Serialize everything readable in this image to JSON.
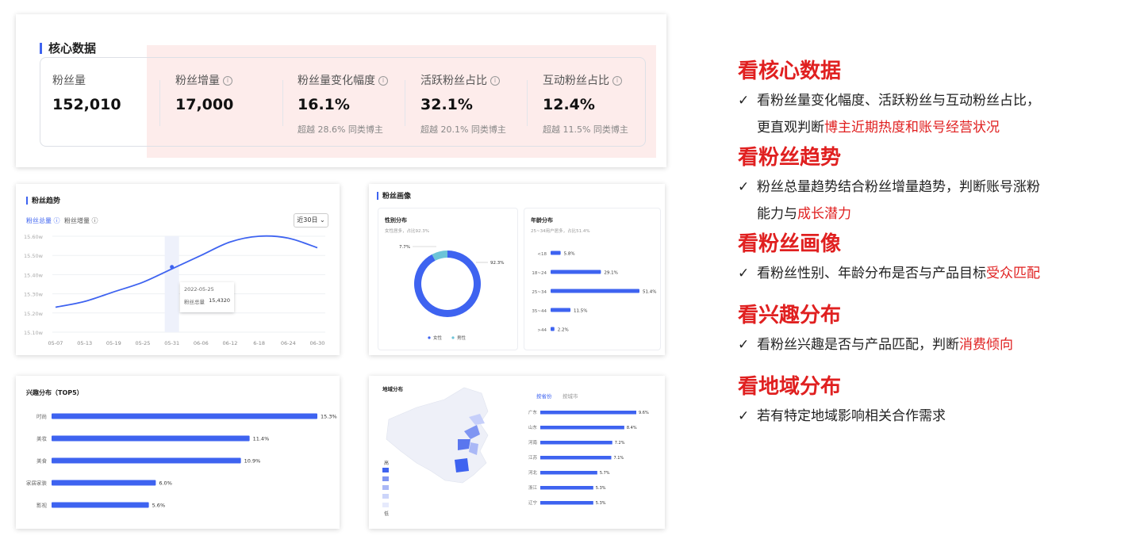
{
  "core": {
    "title": "核心数据",
    "metrics": [
      {
        "label": "粉丝量",
        "value": "152,010",
        "sub": "",
        "info": false
      },
      {
        "label": "粉丝增量",
        "value": "17,000",
        "sub": "",
        "info": true
      },
      {
        "label": "粉丝量变化幅度",
        "value": "16.1%",
        "sub": "超越 28.6% 同类博主",
        "info": true
      },
      {
        "label": "活跃粉丝占比",
        "value": "32.1%",
        "sub": "超越 20.1% 同类博主",
        "info": true
      },
      {
        "label": "互动粉丝占比",
        "value": "12.4%",
        "sub": "超越 11.5% 同类博主",
        "info": true
      }
    ],
    "info_icon": "ⓘ"
  },
  "trend": {
    "title": "粉丝趋势",
    "tab_total": "粉丝总量 ⓘ",
    "tab_increase": "粉丝增量 ⓘ",
    "range_select": "近30日 ⌄",
    "y_ticks": [
      "15.60w",
      "15.50w",
      "15.40w",
      "15.30w",
      "15.20w",
      "15.10w"
    ],
    "x_ticks": [
      "05-07",
      "05-13",
      "05-19",
      "05-25",
      "05-31",
      "06-06",
      "06-12",
      "6-18",
      "06-24",
      "06-30"
    ],
    "tooltip_date": "2022-05-25",
    "tooltip_label": "粉丝总量",
    "tooltip_value": "15,4320",
    "accent": "#3e63f0"
  },
  "portrait": {
    "title": "粉丝画像",
    "gender": {
      "title": "性别分布",
      "subtitle": "女性居多，占比92.3%",
      "female_pct": "92.3%",
      "male_pct": "7.7%",
      "legend_female": "女性",
      "legend_male": "男性",
      "female_color": "#3e63f0",
      "male_color": "#6cc4d8"
    },
    "age": {
      "title": "年龄分布",
      "subtitle": "25~34用户居多，占比51.4%",
      "items": [
        {
          "label": "<18",
          "value": "5.8%"
        },
        {
          "label": "18~24",
          "value": "29.1%"
        },
        {
          "label": "25~34",
          "value": "51.4%"
        },
        {
          "label": "35~44",
          "value": "11.5%"
        },
        {
          "label": ">44",
          "value": "2.2%"
        }
      ]
    }
  },
  "interest": {
    "title": "兴趣分布（TOP5）",
    "items": [
      {
        "label": "时尚",
        "value": "15.3%"
      },
      {
        "label": "美妆",
        "value": "11.4%"
      },
      {
        "label": "美食",
        "value": "10.9%"
      },
      {
        "label": "家居家装",
        "value": "6.0%"
      },
      {
        "label": "影视",
        "value": "5.6%"
      }
    ]
  },
  "region": {
    "title": "地域分布",
    "tab_province": "按省份",
    "tab_city": "按城市",
    "legend_high": "高",
    "legend_low": "低",
    "items": [
      {
        "label": "广东",
        "value": "9.6%"
      },
      {
        "label": "山东",
        "value": "8.4%"
      },
      {
        "label": "河南",
        "value": "7.2%"
      },
      {
        "label": "江苏",
        "value": "7.1%"
      },
      {
        "label": "河北",
        "value": "5.7%"
      },
      {
        "label": "浙江",
        "value": "5.3%"
      },
      {
        "label": "辽宁",
        "value": "5.3%"
      }
    ]
  },
  "chart_data": [
    {
      "type": "line",
      "series": [
        {
          "values": [
            15.23,
            15.26,
            15.31,
            15.36,
            15.43,
            15.5,
            15.57,
            15.6,
            15.59,
            15.54
          ]
        }
      ],
      "x": [
        "05-07",
        "05-13",
        "05-19",
        "05-25",
        "05-31",
        "06-06",
        "06-12",
        "6-18",
        "06-24",
        "06-30"
      ],
      "ylim": [
        15.1,
        15.6
      ]
    },
    {
      "type": "pie",
      "title": "性别分布",
      "categories": [
        "女性",
        "男性"
      ],
      "values": [
        92.3,
        7.7
      ]
    },
    {
      "type": "bar",
      "title": "年龄分布",
      "categories": [
        "<18",
        "18~24",
        "25~34",
        "35~44",
        ">44"
      ],
      "values": [
        5.8,
        29.1,
        51.4,
        11.5,
        2.2
      ]
    },
    {
      "type": "bar",
      "title": "兴趣分布（TOP5）",
      "categories": [
        "时尚",
        "美妆",
        "美食",
        "家居家装",
        "影视"
      ],
      "values": [
        15.3,
        11.4,
        10.9,
        6.0,
        5.6
      ]
    },
    {
      "type": "bar",
      "title": "地域分布",
      "categories": [
        "广东",
        "山东",
        "河南",
        "江苏",
        "河北",
        "浙江",
        "辽宁"
      ],
      "values": [
        9.6,
        8.4,
        7.2,
        7.1,
        5.7,
        5.3,
        5.3
      ]
    }
  ],
  "right": {
    "check": "✓",
    "sections": [
      {
        "heading": "看核心数据",
        "text1": "看粉丝量变化幅度、活跃粉丝与互动粉丝占比，",
        "text2": "更直观判断",
        "red": "博主近期热度和账号经营状况",
        "text3": ""
      },
      {
        "heading": "看粉丝趋势",
        "text1": "粉丝总量趋势结合粉丝增量趋势，判断账号涨粉",
        "text2": "能力与",
        "red": "成长潜力",
        "text3": ""
      },
      {
        "heading": "看粉丝画像",
        "text1": "",
        "text2": "看粉丝性别、年龄分布是否与产品目标",
        "red": "受众匹配",
        "text3": ""
      },
      {
        "heading": "看兴趣分布",
        "text1": "",
        "text2": "看粉丝兴趣是否与产品匹配，判断",
        "red": "消费倾向",
        "text3": ""
      },
      {
        "heading": "看地域分布",
        "text1": "",
        "text2": "若有特定地域影响相关合作需求",
        "red": "",
        "text3": ""
      }
    ]
  }
}
